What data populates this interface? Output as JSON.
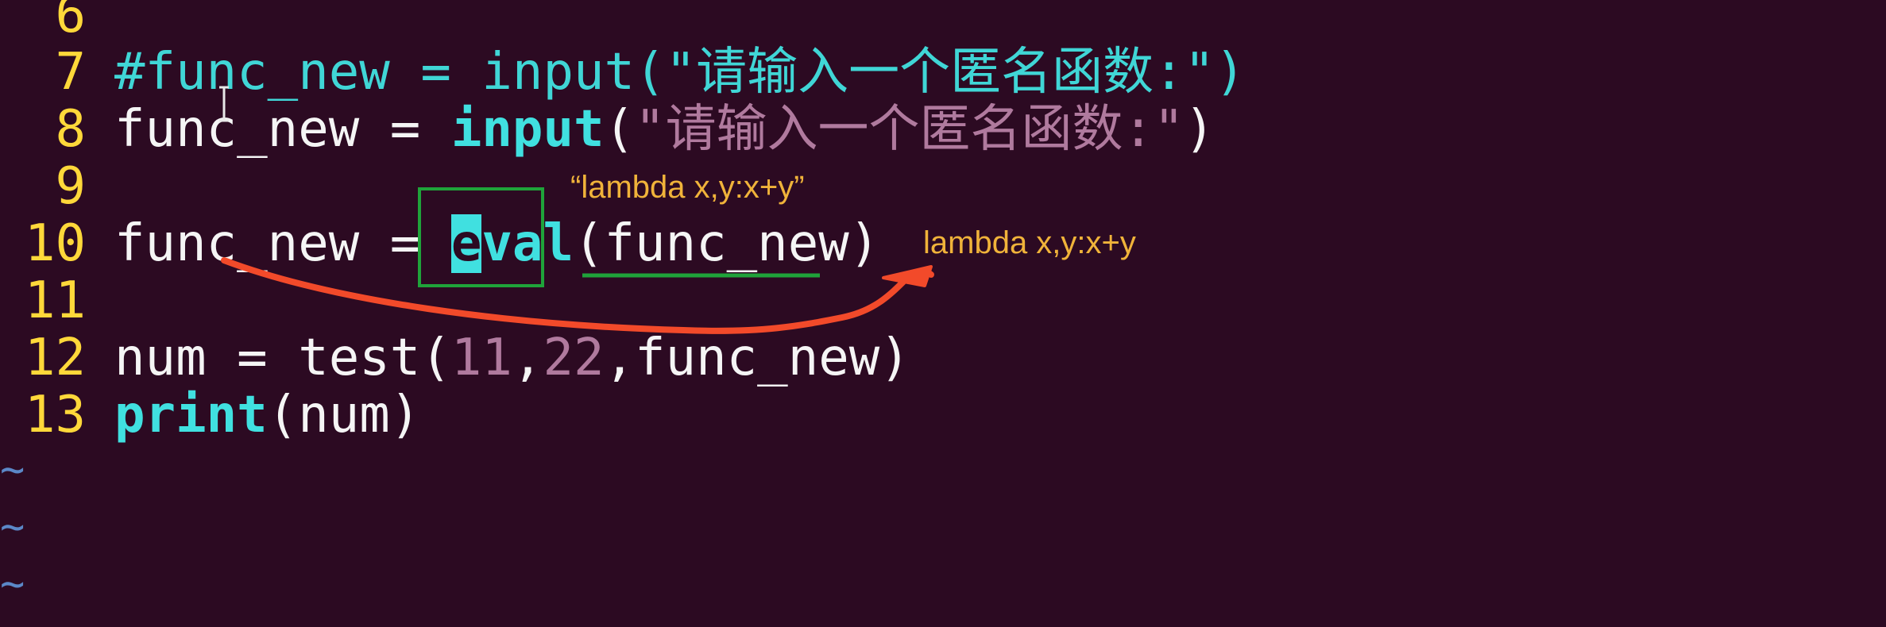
{
  "editor": {
    "lines": [
      {
        "number": "6",
        "segments": []
      },
      {
        "number": "7",
        "segments": [
          {
            "text": "#func_new = input(\"请输入一个匿名函数:\")",
            "style": "cmt"
          }
        ]
      },
      {
        "number": "8",
        "segments": [
          {
            "text": "func_new = ",
            "style": ""
          },
          {
            "text": "input",
            "style": "kw"
          },
          {
            "text": "(",
            "style": ""
          },
          {
            "text": "\"请输入一个匿名函数:\"",
            "style": "str"
          },
          {
            "text": ")",
            "style": ""
          }
        ]
      },
      {
        "number": "9",
        "segments": []
      },
      {
        "number": "10",
        "segments": [
          {
            "text": "func_new = ",
            "style": ""
          },
          {
            "text": "e",
            "style": "kw cursor-char"
          },
          {
            "text": "val",
            "style": "kw"
          },
          {
            "text": "(func_new)",
            "style": ""
          }
        ]
      },
      {
        "number": "11",
        "segments": []
      },
      {
        "number": "12",
        "segments": [
          {
            "text": "num = test(",
            "style": ""
          },
          {
            "text": "11",
            "style": "num"
          },
          {
            "text": ",",
            "style": ""
          },
          {
            "text": "22",
            "style": "num"
          },
          {
            "text": ",func_new)",
            "style": ""
          }
        ]
      },
      {
        "number": "13",
        "segments": [
          {
            "text": "print",
            "style": "kw"
          },
          {
            "text": "(num)",
            "style": ""
          }
        ]
      }
    ],
    "empty_marker": "~",
    "empty_marker_count": 3
  },
  "annotations": {
    "quoted_string": "“lambda x,y:x+y”",
    "result_value": "lambda x,y:x+y"
  },
  "colors": {
    "background": "#2c0a22",
    "line_number": "#ffd83a",
    "keyword": "#40e0e0",
    "string": "#b07a9e",
    "annotation_text": "#f0b33a",
    "box_highlight": "#1fa33a",
    "arrow": "#f24a2a",
    "tilde": "#5b88c8"
  }
}
